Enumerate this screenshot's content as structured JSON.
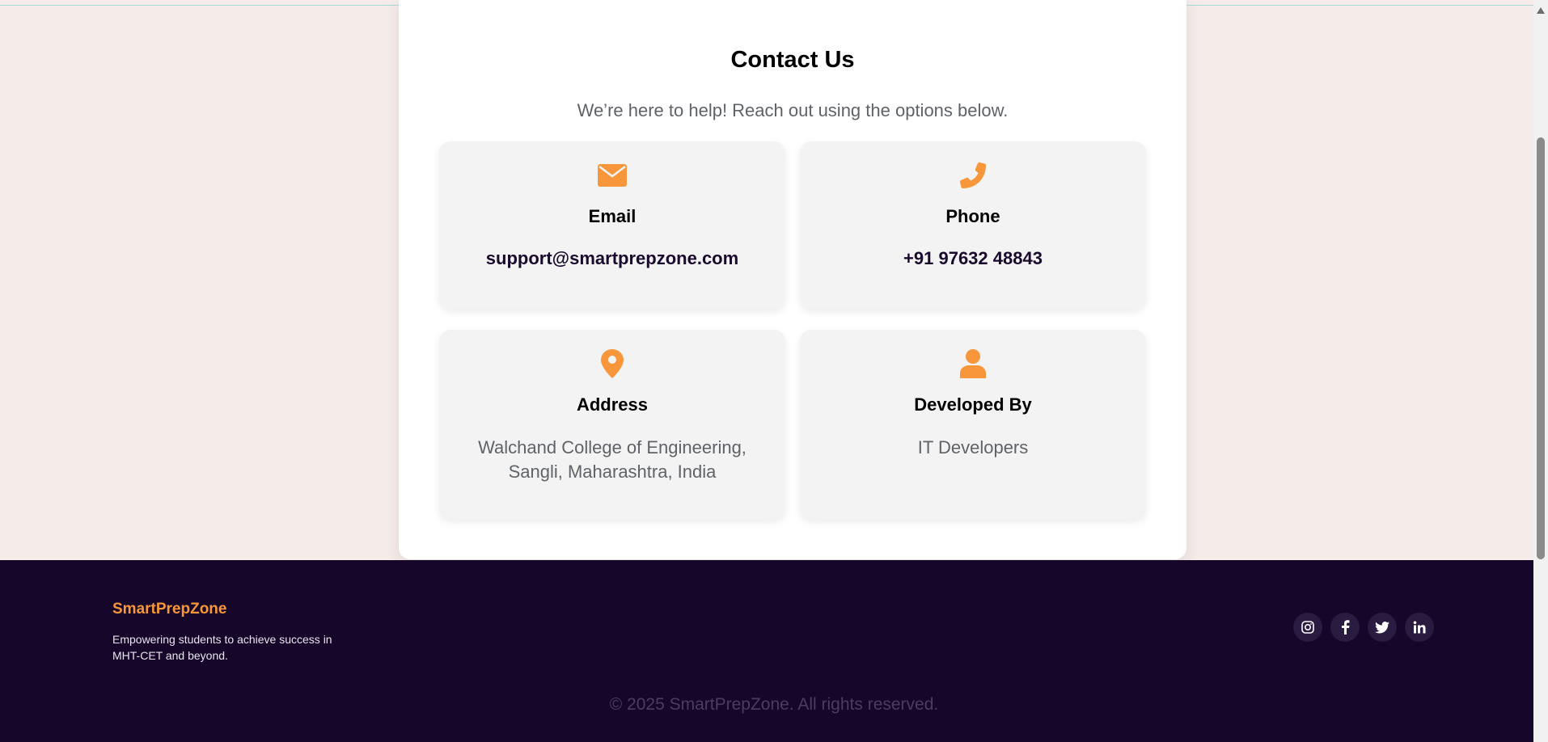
{
  "contact": {
    "title": "Contact Us",
    "subtitle": "We’re here to help! Reach out using the options below.",
    "cards": {
      "email": {
        "icon": "envelope-icon",
        "heading": "Email",
        "value": "support@smartprepzone.com"
      },
      "phone": {
        "icon": "phone-icon",
        "heading": "Phone",
        "value": "+91 97632 48843"
      },
      "address": {
        "icon": "map-pin-icon",
        "heading": "Address",
        "value": "Walchand College of Engineering, Sangli, Maharashtra, India"
      },
      "developer": {
        "icon": "user-icon",
        "heading": "Developed By",
        "value": "IT Developers"
      }
    },
    "accent_color": "#f7963a"
  },
  "footer": {
    "brand": "SmartPrepZone",
    "tagline": "Empowering students to achieve success in MHT-CET and beyond.",
    "social": [
      {
        "icon": "instagram-icon"
      },
      {
        "icon": "facebook-icon"
      },
      {
        "icon": "twitter-icon"
      },
      {
        "icon": "linkedin-icon"
      }
    ],
    "copyright": "© 2025 SmartPrepZone. All rights reserved.",
    "background": "#15062a"
  }
}
